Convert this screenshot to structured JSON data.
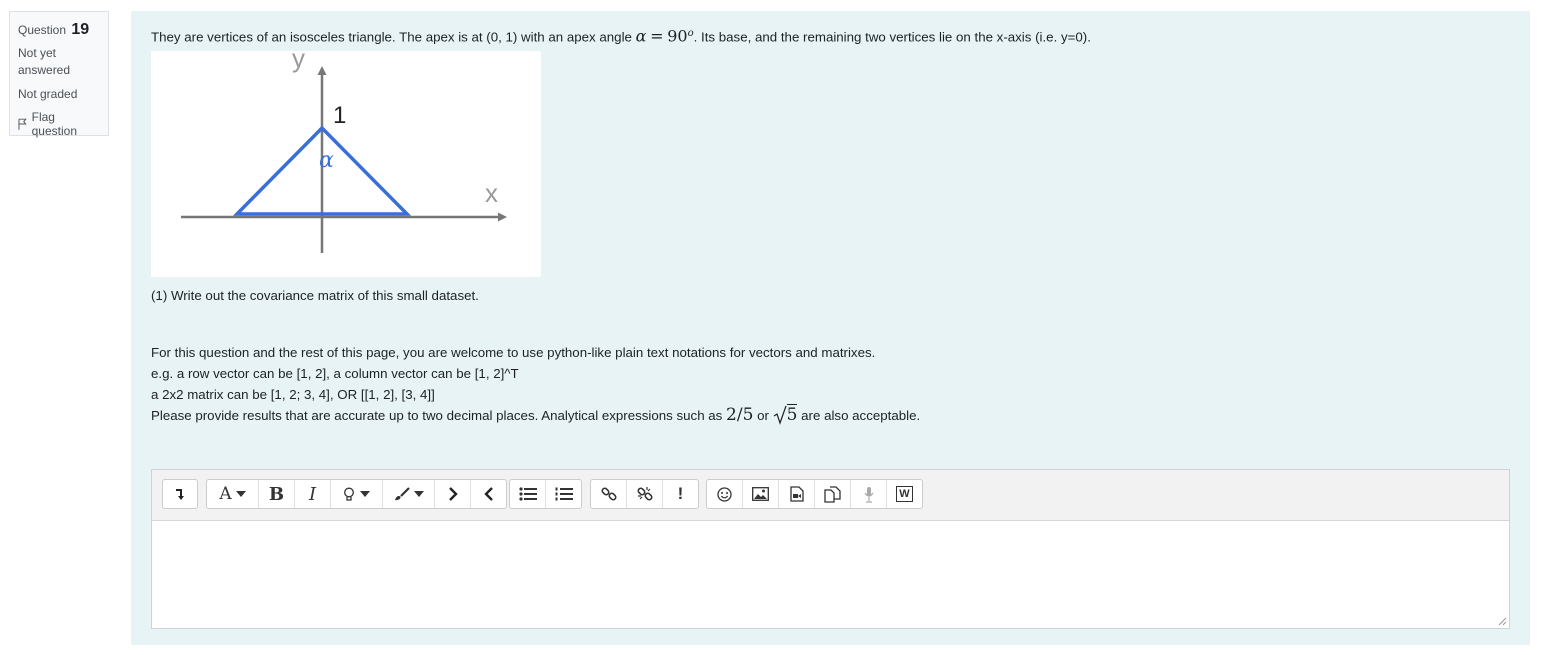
{
  "info": {
    "question_word": "Question",
    "question_number": "19",
    "state": "Not yet answered",
    "grade": "Not graded",
    "flag_label": "Flag question"
  },
  "question": {
    "intro_pre": "They are vertices of an isosceles triangle. The apex is at (0, 1) with an apex angle",
    "alpha": "α",
    "equals": "=",
    "ninety": "90",
    "degree": "o",
    "intro_post": ". Its base, and the remaining two vertices lie on the x-axis (i.e. y=0).",
    "part1": "(1) Write out the covariance matrix of this small dataset.",
    "line1": "For this question and the rest of this page, you are welcome to use python-like plain text notations for vectors and matrixes.",
    "line2": "e.g. a row vector can be [1, 2], a column vector can be [1, 2]^T",
    "line3": "a 2x2 matrix can be [1, 2; 3, 4], OR [[1, 2], [3, 4]]",
    "line4_pre": "Please provide results that are accurate up to two decimal places.  Analytical expressions such as",
    "expr1": "2/5",
    "or_word": "or",
    "sqrt_arg": "5",
    "line4_post": "are also acceptable."
  },
  "figure": {
    "y_label": "y",
    "x_label": "x",
    "apex_label": "1",
    "angle_label": "α",
    "triangle_color": "#3a6fd8",
    "axis_color": "#777777"
  },
  "editor": {
    "toolbar": [
      "collapse",
      "font-color",
      "bold",
      "italic",
      "highlight",
      "brush",
      "ltr",
      "rtl",
      "unordered-list",
      "ordered-list",
      "link",
      "unlink",
      "alert",
      "emoji",
      "image",
      "media",
      "manage-files",
      "record-audio",
      "word-import"
    ],
    "bold_label": "B",
    "italic_label": "I",
    "font_label": "A",
    "word_label": "W"
  }
}
